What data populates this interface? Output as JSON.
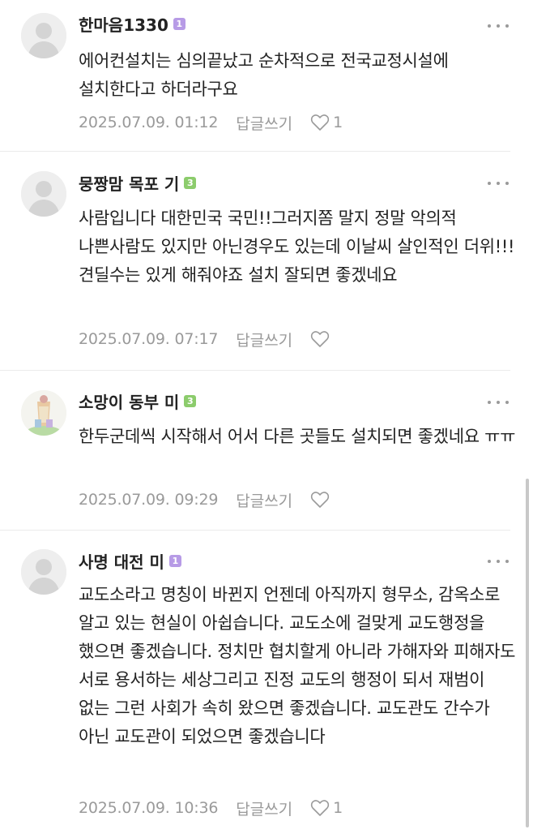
{
  "colors": {
    "badge_purple": "#b79be6",
    "badge_green": "#8ccc6c",
    "meta_gray": "#9a9a9a",
    "text": "#222222"
  },
  "comments": [
    {
      "nickname": "한마음1330",
      "badge": "1",
      "badge_color": "#b79be6",
      "avatar": "default-avatar",
      "text": "에어컨설치는 심의끝났고 순차적으로 전국교정시설에 설치한다고 하더라구요",
      "date": "2025.07.09. 01:12",
      "reply_label": "답글쓰기",
      "like_count": "1"
    },
    {
      "nickname": "뭉짱맘 목포 기",
      "badge": "3",
      "badge_color": "#8ccc6c",
      "avatar": "default-avatar",
      "text": "사람입니다 대한민국 국민!!그러지쫌 말지 정말 악의적 나쁜사람도 있지만 아닌경우도 있는데 이날씨 살인적인 더위!!! 견딜수는 있게 해줘야죠 설치 잘되면 좋겠네요",
      "date": "2025.07.09. 07:17",
      "reply_label": "답글쓰기",
      "like_count": ""
    },
    {
      "nickname": "소망이 동부 미",
      "badge": "3",
      "badge_color": "#8ccc6c",
      "avatar": "profile-photo",
      "text": "한두군데씩 시작해서 어서 다른 곳들도 설치되면 좋겠네요 ㅠㅠ",
      "date": "2025.07.09. 09:29",
      "reply_label": "답글쓰기",
      "like_count": ""
    },
    {
      "nickname": "사명 대전 미",
      "badge": "1",
      "badge_color": "#b79be6",
      "avatar": "default-avatar",
      "text": "교도소라고 명칭이 바뀐지 언젠데 아직까지 형무소, 감옥소로 알고 있는 현실이 아쉽습니다. 교도소에 걸맞게 교도행정을 했으면 좋겠습니다. 정치만 협치할게 아니라 가해자와 피해자도 서로 용서하는 세상그리고 진정 교도의 행정이 되서 재범이 없는 그런 사회가 속히 왔으면 좋겠습니다. 교도관도 간수가 아닌 교도관이 되었으면 좋겠습니다",
      "date": "2025.07.09. 10:36",
      "reply_label": "답글쓰기",
      "like_count": "1"
    }
  ]
}
